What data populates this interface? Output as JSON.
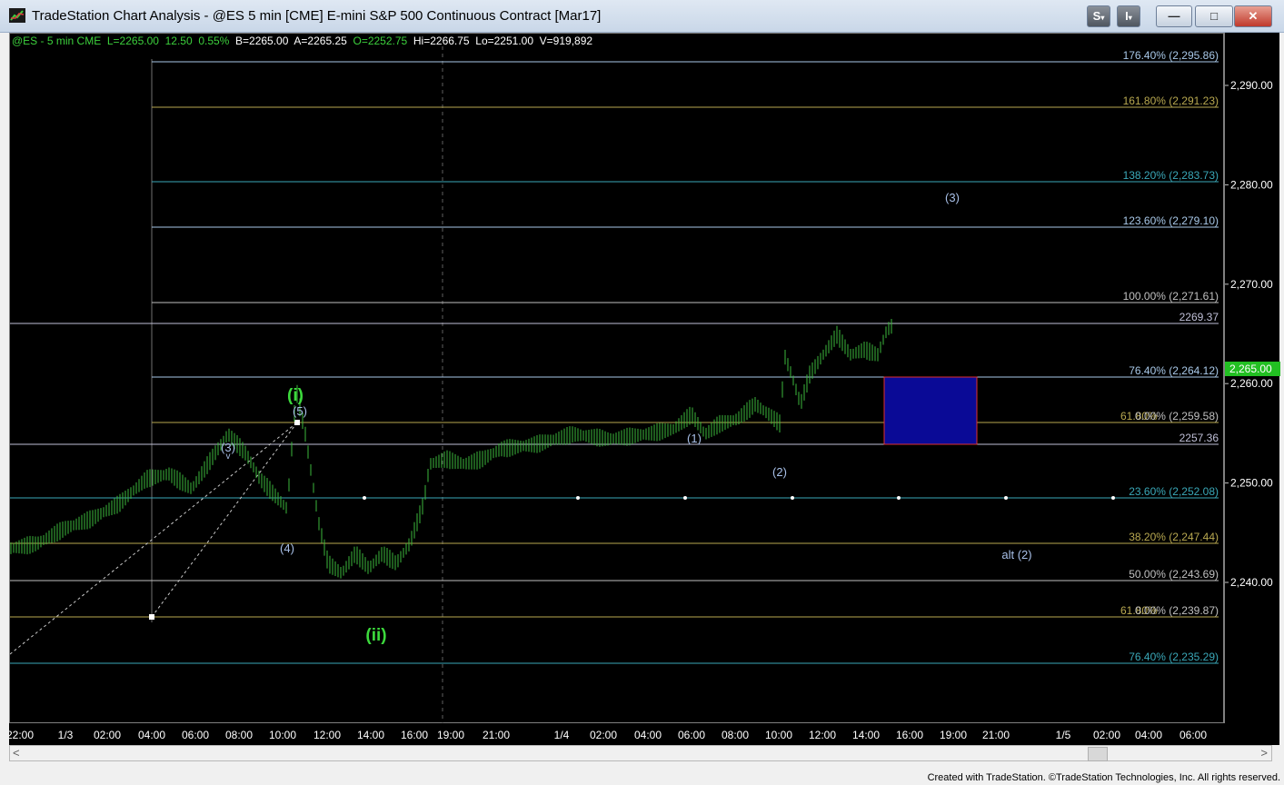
{
  "window": {
    "title": "TradeStation Chart Analysis - @ES 5 min [CME] E-mini S&P 500 Continuous Contract [Mar17]",
    "btn_s": "S",
    "btn_i": "I",
    "minimize": "—",
    "maximize": "□",
    "close": "✕"
  },
  "status": {
    "symbol": "@ES - 5 min CME",
    "last": "L=2265.00",
    "change": "12.50",
    "pct": "0.55%",
    "bid": "B=2265.00",
    "ask": "A=2265.25",
    "open": "O=2252.75",
    "high": "Hi=2266.75",
    "low": "Lo=2251.00",
    "volume": "V=919,892"
  },
  "price_axis": {
    "ticks": [
      "2,290.00",
      "2,280.00",
      "2,270.00",
      "2,260.00",
      "2,250.00",
      "2,240.00"
    ],
    "last_price_tag": "2,265.00"
  },
  "time_axis": {
    "ticks": [
      "22:00",
      "1/3",
      "02:00",
      "04:00",
      "06:00",
      "08:00",
      "10:00",
      "12:00",
      "14:00",
      "16:00",
      "19:00",
      "21:00",
      "1/4",
      "02:00",
      "04:00",
      "06:00",
      "08:00",
      "10:00",
      "12:00",
      "14:00",
      "16:00",
      "19:00",
      "21:00",
      "1/5",
      "02:00",
      "04:00",
      "06:00"
    ]
  },
  "fib_levels": [
    {
      "label": "176.40% (2,295.86)",
      "color": "#a8c8e8"
    },
    {
      "label": "161.80% (2,291.23)",
      "color": "#b8a850"
    },
    {
      "label": "138.20% (2,283.73)",
      "color": "#3aa8b8"
    },
    {
      "label": "123.60% (2,279.10)",
      "color": "#a8c8e8"
    },
    {
      "label": "100.00% (2,271.61)",
      "color": "#c0c0c0"
    },
    {
      "label": "2269.37",
      "color": "#c0c0d8"
    },
    {
      "label": "76.40% (2,264.12)",
      "color": "#a8c8e8"
    },
    {
      "label": "61.80%",
      "color": "#b8a850"
    },
    {
      "label": "0.00% (2,259.58)",
      "color": "#c0c0c0"
    },
    {
      "label": "2257.36",
      "color": "#c0c0d8"
    },
    {
      "label": "23.60% (2,252.08)",
      "color": "#3aa8b8"
    },
    {
      "label": "38.20% (2,247.44)",
      "color": "#b8a850"
    },
    {
      "label": "50.00% (2,243.69)",
      "color": "#c0c0c0"
    },
    {
      "label": "61.80%",
      "color": "#b8a850"
    },
    {
      "label": "0.00% (2,239.87)",
      "color": "#c0c0c0"
    },
    {
      "label": "76.40% (2,235.29)",
      "color": "#3aa8b8"
    }
  ],
  "wave_labels": {
    "i": "(i)",
    "ii": "(ii)",
    "w3a": "(3)",
    "w4": "(4)",
    "w5": "(5)",
    "w1": "(1)",
    "w2": "(2)",
    "w3b": "(3)",
    "alt2": "alt (2)"
  },
  "footer": "Created with TradeStation. ©TradeStation Technologies, Inc. All rights reserved.",
  "colors": {
    "price": "#3cb93c",
    "wave_primary": "#3cd93c",
    "wave_minor": "#a8c0e8",
    "target_box": "#0a0a96",
    "target_border": "#e03030",
    "last_price_bg": "#22c022"
  }
}
